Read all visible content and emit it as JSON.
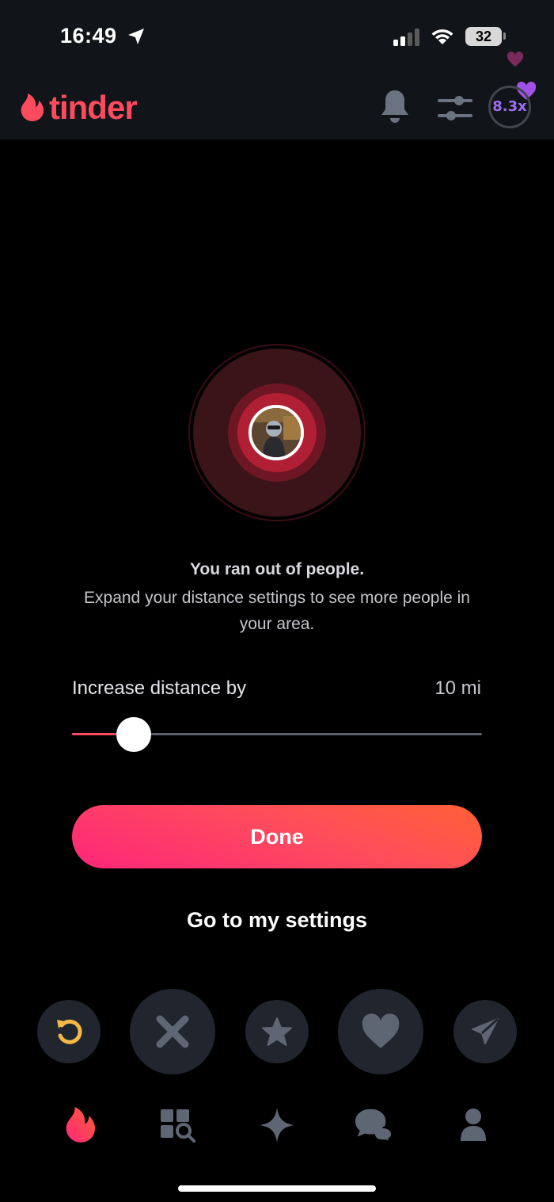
{
  "status_bar": {
    "time": "16:49",
    "battery": "32"
  },
  "header": {
    "logo_text": "tinder",
    "boost_multiplier": "8.3x"
  },
  "empty_state": {
    "title": "You ran out of people.",
    "body": "Expand your distance settings to see more people in your area."
  },
  "distance": {
    "label": "Increase distance by",
    "value_text": "10 mi",
    "slider_fraction": 0.15
  },
  "buttons": {
    "done": "Done",
    "settings_link": "Go to my settings"
  },
  "actions": [
    "rewind-icon",
    "nope-icon",
    "super-like-icon",
    "like-icon",
    "boost-send-icon"
  ],
  "tabs": [
    "flame-icon",
    "explore-icon",
    "sparkle-icon",
    "chat-icon",
    "profile-icon"
  ],
  "colors": {
    "brand": "#fd4b5e",
    "gradient_start": "#fd267a",
    "gradient_end": "#ff6036",
    "boost_purple": "#9c6ef4",
    "rewind_yellow": "#f5b748",
    "inactive_icon": "#5f6673",
    "topbar_bg": "#111418"
  }
}
